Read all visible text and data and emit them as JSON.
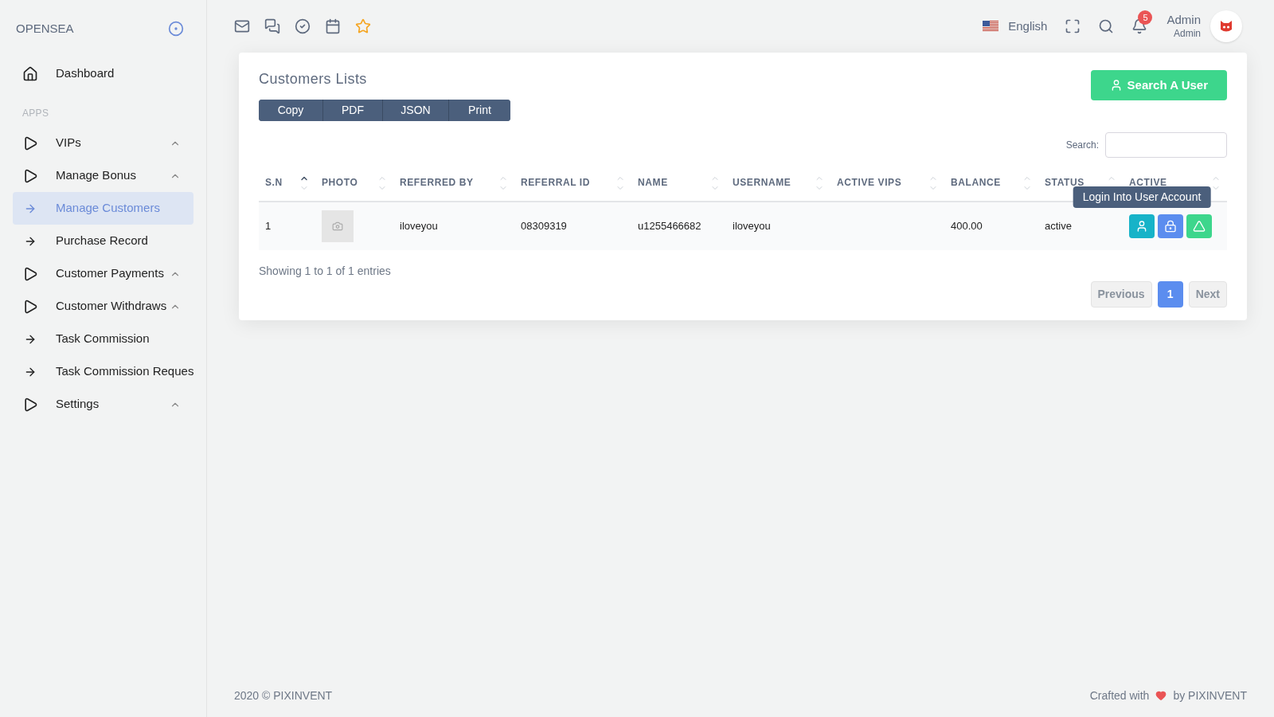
{
  "sidebar": {
    "brand": "OPENSEA",
    "section_label": "APPS",
    "items": [
      {
        "label": "Dashboard",
        "kind": "home",
        "selected": false
      },
      {
        "label": "VIPs",
        "kind": "group",
        "selected": false
      },
      {
        "label": "Manage Bonus",
        "kind": "group",
        "selected": false
      },
      {
        "label": "Manage Customers",
        "kind": "link",
        "selected": true
      },
      {
        "label": "Purchase Record",
        "kind": "link",
        "selected": false
      },
      {
        "label": "Customer Payments",
        "kind": "group",
        "selected": false
      },
      {
        "label": "Customer Withdraws",
        "kind": "group",
        "selected": false
      },
      {
        "label": "Task Commission",
        "kind": "link",
        "selected": false
      },
      {
        "label": "Task Commission Reques",
        "kind": "link",
        "selected": false
      },
      {
        "label": "Settings",
        "kind": "group",
        "selected": false
      }
    ]
  },
  "topbar": {
    "language": "English",
    "notification_count": "5",
    "user_name": "Admin",
    "user_role": "Admin"
  },
  "card": {
    "title": "Customers Lists",
    "export_buttons": [
      "Copy",
      "PDF",
      "JSON",
      "Print"
    ],
    "search_button": "Search A User",
    "search_label": "Search:",
    "table": {
      "columns": [
        {
          "label": "S.N",
          "sorted": true
        },
        {
          "label": "PHOTO",
          "sorted": false
        },
        {
          "label": "REFERRED BY",
          "sorted": false
        },
        {
          "label": "REFERRAL ID",
          "sorted": false
        },
        {
          "label": "NAME",
          "sorted": false
        },
        {
          "label": "USERNAME",
          "sorted": false
        },
        {
          "label": "ACTIVE VIPS",
          "sorted": false
        },
        {
          "label": "BALANCE",
          "sorted": false
        },
        {
          "label": "STATUS",
          "sorted": false
        },
        {
          "label": "ACTIVE",
          "sorted": false
        }
      ],
      "rows": [
        {
          "sn": "1",
          "referred_by": "iloveyou",
          "referral_id": "08309319",
          "name": "u1255466682",
          "username": "iloveyou",
          "balance": "400.00",
          "status": "active"
        }
      ]
    },
    "tooltip": "Login Into User Account",
    "info": "Showing 1 to 1 of 1 entries",
    "pagination": {
      "previous": "Previous",
      "pages": [
        {
          "label": "1",
          "selected": true
        }
      ],
      "next": "Next"
    }
  },
  "footer": {
    "copyright": "2020 © PIXINVENT",
    "crafted": "Crafted with",
    "by": "by PIXINVENT"
  }
}
